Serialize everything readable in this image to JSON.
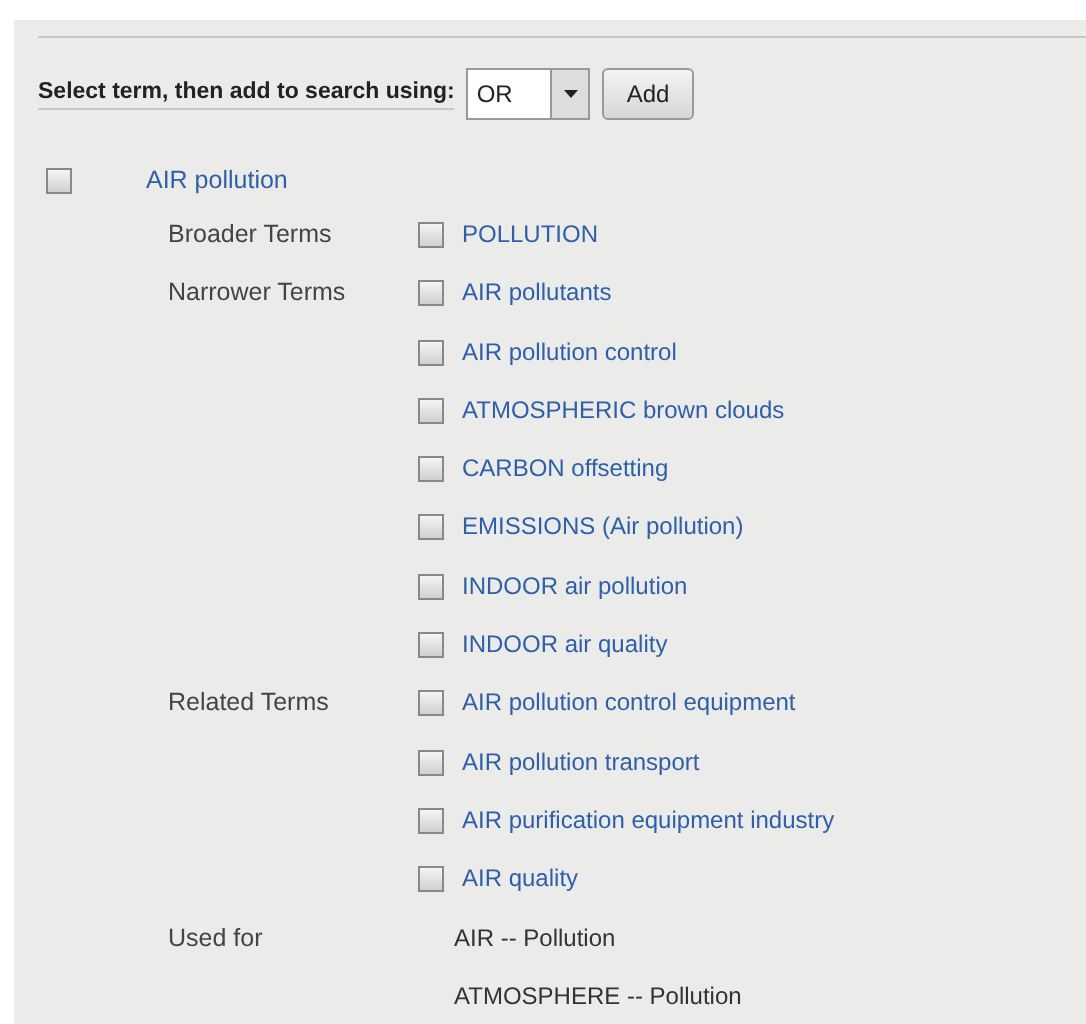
{
  "toolbar": {
    "label": "Select term, then add to search using:",
    "operator": "OR",
    "button": "Add"
  },
  "term": {
    "label": "AIR pollution",
    "checked": false
  },
  "sections": [
    {
      "label": "Broader Terms",
      "items": [
        {
          "kind": "term",
          "label": "POLLUTION",
          "checked": false
        }
      ]
    },
    {
      "label": "Narrower Terms",
      "items": [
        {
          "kind": "term",
          "label": "AIR pollutants",
          "checked": false
        },
        {
          "kind": "term",
          "label": "AIR pollution control",
          "checked": false
        },
        {
          "kind": "term",
          "label": "ATMOSPHERIC brown clouds",
          "checked": false
        },
        {
          "kind": "term",
          "label": "CARBON offsetting",
          "checked": false
        },
        {
          "kind": "term",
          "label": "EMISSIONS (Air pollution)",
          "checked": false
        },
        {
          "kind": "term",
          "label": "INDOOR air pollution",
          "checked": false
        },
        {
          "kind": "term",
          "label": "INDOOR air quality",
          "checked": false
        }
      ]
    },
    {
      "label": "Related Terms",
      "items": [
        {
          "kind": "term",
          "label": "AIR pollution control equipment",
          "checked": false
        },
        {
          "kind": "term",
          "label": "AIR pollution transport",
          "checked": false
        },
        {
          "kind": "term",
          "label": "AIR purification equipment industry",
          "checked": false
        },
        {
          "kind": "term",
          "label": "AIR quality",
          "checked": false
        }
      ]
    },
    {
      "label": "Used for",
      "items": [
        {
          "kind": "text",
          "label": "AIR -- Pollution"
        },
        {
          "kind": "text",
          "label": "ATMOSPHERE -- Pollution"
        }
      ]
    }
  ]
}
